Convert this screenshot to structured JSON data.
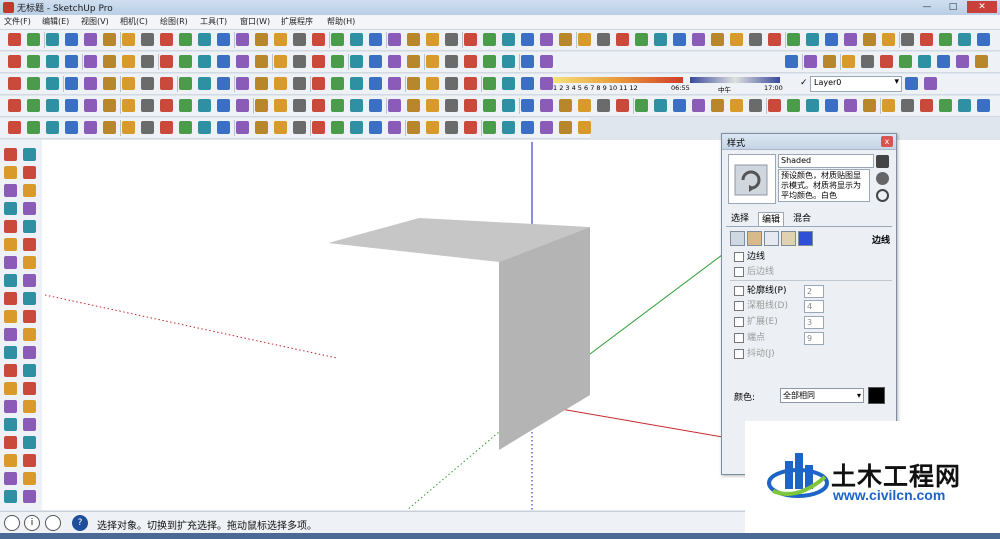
{
  "window": {
    "title": "无标题 - SketchUp Pro",
    "minimize": "—",
    "maximize": "□",
    "close": "✕"
  },
  "menu": [
    "文件(F)",
    "编辑(E)",
    "视图(V)",
    "相机(C)",
    "绘图(R)",
    "工具(T)",
    "窗口(W)",
    "扩展程序",
    "帮助(H)"
  ],
  "toolbar": {
    "shadow_ticks": "1 2 3 4 5 6 7 8 9 10 11 12",
    "time_start": "06:55",
    "time_mid": "中午",
    "time_end": "17:00",
    "layer_check": "✓",
    "layer_name": "Layer0",
    "layer_arrow": "▾"
  },
  "status": {
    "text": "选择对象。切换到扩充选择。拖动鼠标选择多项。",
    "help_icon": "?",
    "info_icon": "i"
  },
  "styles_panel": {
    "title": "样式",
    "close": "x",
    "style_name": "Shaded",
    "description": "预设颜色，材质贴图显示模式。材质将显示为平均颜色。白色",
    "tabs": [
      "选择",
      "编辑",
      "混合"
    ],
    "active_tab": "编辑",
    "edge_heading": "边线",
    "options": [
      {
        "label": "边线",
        "enabled": true
      },
      {
        "label": "后边线",
        "enabled": false
      },
      {
        "label": "轮廓线(P)",
        "enabled": true,
        "value": "2"
      },
      {
        "label": "深粗线(D)",
        "enabled": false,
        "value": "4"
      },
      {
        "label": "扩展(E)",
        "enabled": false,
        "value": "3"
      },
      {
        "label": "端点",
        "enabled": false,
        "value": "9"
      },
      {
        "label": "抖动(J)",
        "enabled": false
      }
    ],
    "color_label": "颜色:",
    "color_value": "全部相同",
    "color_swatch": "#000000"
  },
  "watermark": {
    "title": "土木工程网",
    "url": "www.civilcn.com"
  },
  "colors": {
    "axis_blue": "#1a1acc",
    "axis_red": "#c62828",
    "axis_green": "#2e9e2e",
    "box_top": "#c6c6c6",
    "box_front": "#b4b4b4"
  }
}
